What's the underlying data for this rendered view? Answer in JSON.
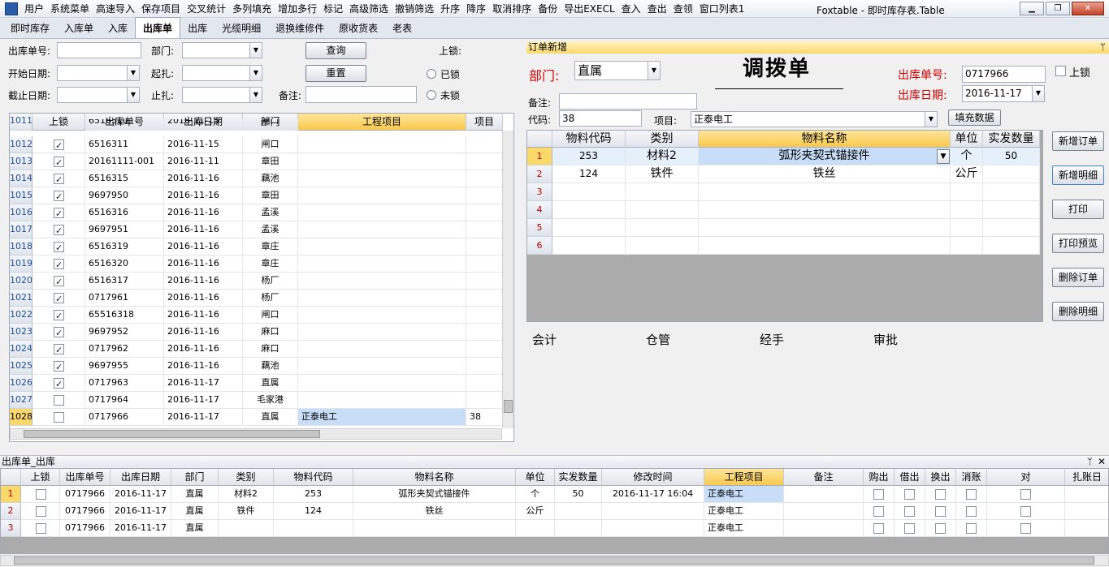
{
  "menu": {
    "items": [
      "用户",
      "系统菜单",
      "高速导入",
      "保存项目",
      "交叉统计",
      "多列填充",
      "增加多行",
      "标记",
      "高级筛选",
      "撤销筛选",
      "升序",
      "降序",
      "取消排序",
      "备份",
      "导出EXECL",
      "查入",
      "查出",
      "查领",
      "窗口列表1"
    ],
    "title": "Foxtable - 即时库存表.Table"
  },
  "tabs": [
    "即时库存",
    "入库单",
    "入库",
    "出库单",
    "出库",
    "光缆明细",
    "退换维修件",
    "原收货表",
    "老表"
  ],
  "tab_active": 3,
  "filters": {
    "out_no_label": "出库单号:",
    "start_date_label": "开始日期:",
    "end_date_label": "截止日期:",
    "dept_label": "部门:",
    "start_tie_label": "起扎:",
    "end_tie_label": "止扎:",
    "remark_label": "备注:",
    "lock_label": "上锁:",
    "locked_label": "已锁",
    "unlocked_label": "未锁",
    "query_button": "查询",
    "reset_button": "重置"
  },
  "left_grid": {
    "headers": [
      "上锁",
      "出库单号",
      "出库日期",
      "部门",
      "工程项目",
      "项目"
    ],
    "partial_row": {
      "no": "1011",
      "out_no": "6516310",
      "date": "2016-11-15",
      "dept": "闸口"
    },
    "rows": [
      {
        "no": "1012",
        "locked": true,
        "out_no": "6516311",
        "date": "2016-11-15",
        "dept": "闸口",
        "project": "",
        "item": ""
      },
      {
        "no": "1013",
        "locked": true,
        "out_no": "20161111-001",
        "date": "2016-11-11",
        "dept": "章田",
        "project": "",
        "item": ""
      },
      {
        "no": "1014",
        "locked": true,
        "out_no": "6516315",
        "date": "2016-11-16",
        "dept": "藕池",
        "project": "",
        "item": ""
      },
      {
        "no": "1015",
        "locked": true,
        "out_no": "9697950",
        "date": "2016-11-16",
        "dept": "章田",
        "project": "",
        "item": ""
      },
      {
        "no": "1016",
        "locked": true,
        "out_no": "6516316",
        "date": "2016-11-16",
        "dept": "孟溪",
        "project": "",
        "item": ""
      },
      {
        "no": "1017",
        "locked": true,
        "out_no": "9697951",
        "date": "2016-11-16",
        "dept": "孟溪",
        "project": "",
        "item": ""
      },
      {
        "no": "1018",
        "locked": true,
        "out_no": "6516319",
        "date": "2016-11-16",
        "dept": "章庄",
        "project": "",
        "item": ""
      },
      {
        "no": "1019",
        "locked": true,
        "out_no": "6516320",
        "date": "2016-11-16",
        "dept": "章庄",
        "project": "",
        "item": ""
      },
      {
        "no": "1020",
        "locked": true,
        "out_no": "6516317",
        "date": "2016-11-16",
        "dept": "杨厂",
        "project": "",
        "item": ""
      },
      {
        "no": "1021",
        "locked": true,
        "out_no": "0717961",
        "date": "2016-11-16",
        "dept": "杨厂",
        "project": "",
        "item": ""
      },
      {
        "no": "1022",
        "locked": true,
        "out_no": "65516318",
        "date": "2016-11-16",
        "dept": "闸口",
        "project": "",
        "item": ""
      },
      {
        "no": "1023",
        "locked": true,
        "out_no": "9697952",
        "date": "2016-11-16",
        "dept": "麻口",
        "project": "",
        "item": ""
      },
      {
        "no": "1024",
        "locked": true,
        "out_no": "0717962",
        "date": "2016-11-16",
        "dept": "麻口",
        "project": "",
        "item": ""
      },
      {
        "no": "1025",
        "locked": true,
        "out_no": "9697955",
        "date": "2016-11-16",
        "dept": "藕池",
        "project": "",
        "item": ""
      },
      {
        "no": "1026",
        "locked": true,
        "out_no": "0717963",
        "date": "2016-11-17",
        "dept": "直属",
        "project": "",
        "item": ""
      },
      {
        "no": "1027",
        "locked": false,
        "out_no": "0717964",
        "date": "2016-11-17",
        "dept": "毛家港",
        "project": "",
        "item": ""
      },
      {
        "no": "1028",
        "locked": false,
        "out_no": "0717966",
        "date": "2016-11-17",
        "dept": "直属",
        "project": "正泰电工",
        "item": "38"
      }
    ]
  },
  "order": {
    "panel_title": "订单新增",
    "dept_label": "部门:",
    "dept_value": "直属",
    "title": "调拨单",
    "out_no_label": "出库单号:",
    "out_no_value": "0717966",
    "out_date_label": "出库日期:",
    "out_date_value": "2016-11-17",
    "lock_label": "上锁",
    "remark_label": "备注:",
    "code_label": "代码:",
    "code_value": "38",
    "project_label": "项目:",
    "project_value": "正泰电工",
    "fill_button": "填充数据",
    "headers": [
      "物料代码",
      "类别",
      "物料名称",
      "单位",
      "实发数量"
    ],
    "rows": [
      {
        "no": "1",
        "code": "253",
        "cat": "材料2",
        "name": "弧形夹契式锚接件",
        "unit": "个",
        "qty": "50"
      },
      {
        "no": "2",
        "code": "124",
        "cat": "铁件",
        "name": "铁丝",
        "unit": "公斤",
        "qty": ""
      },
      {
        "no": "3",
        "code": "",
        "cat": "",
        "name": "",
        "unit": "",
        "qty": ""
      },
      {
        "no": "4",
        "code": "",
        "cat": "",
        "name": "",
        "unit": "",
        "qty": ""
      },
      {
        "no": "5",
        "code": "",
        "cat": "",
        "name": "",
        "unit": "",
        "qty": ""
      },
      {
        "no": "6",
        "code": "",
        "cat": "",
        "name": "",
        "unit": "",
        "qty": ""
      }
    ],
    "signatures": [
      "会计",
      "仓管",
      "经手",
      "审批"
    ],
    "buttons": [
      "新增订单",
      "新增明细",
      "打印",
      "打印预览",
      "删除订单",
      "删除明细"
    ]
  },
  "bottom": {
    "panel_title": "出库单_出库",
    "headers": [
      "上锁",
      "出库单号",
      "出库日期",
      "部门",
      "类别",
      "物料代码",
      "物料名称",
      "单位",
      "实发数量",
      "修改时间",
      "工程项目",
      "备注",
      "购出",
      "借出",
      "换出",
      "消账",
      "对",
      "扎账日"
    ],
    "rows": [
      {
        "no": "1",
        "out_no": "0717966",
        "date": "2016-11-17",
        "dept": "直属",
        "cat": "材料2",
        "code": "253",
        "name": "弧形夹契式锚接件",
        "unit": "个",
        "qty": "50",
        "mtime": "2016-11-17 16:04",
        "project": "正泰电工"
      },
      {
        "no": "2",
        "out_no": "0717966",
        "date": "2016-11-17",
        "dept": "直属",
        "cat": "铁件",
        "code": "124",
        "name": "铁丝",
        "unit": "公斤",
        "qty": "",
        "mtime": "",
        "project": "正泰电工"
      },
      {
        "no": "3",
        "out_no": "0717966",
        "date": "2016-11-17",
        "dept": "直属",
        "cat": "",
        "code": "",
        "name": "",
        "unit": "",
        "qty": "",
        "mtime": "",
        "project": "正泰电工"
      }
    ]
  }
}
